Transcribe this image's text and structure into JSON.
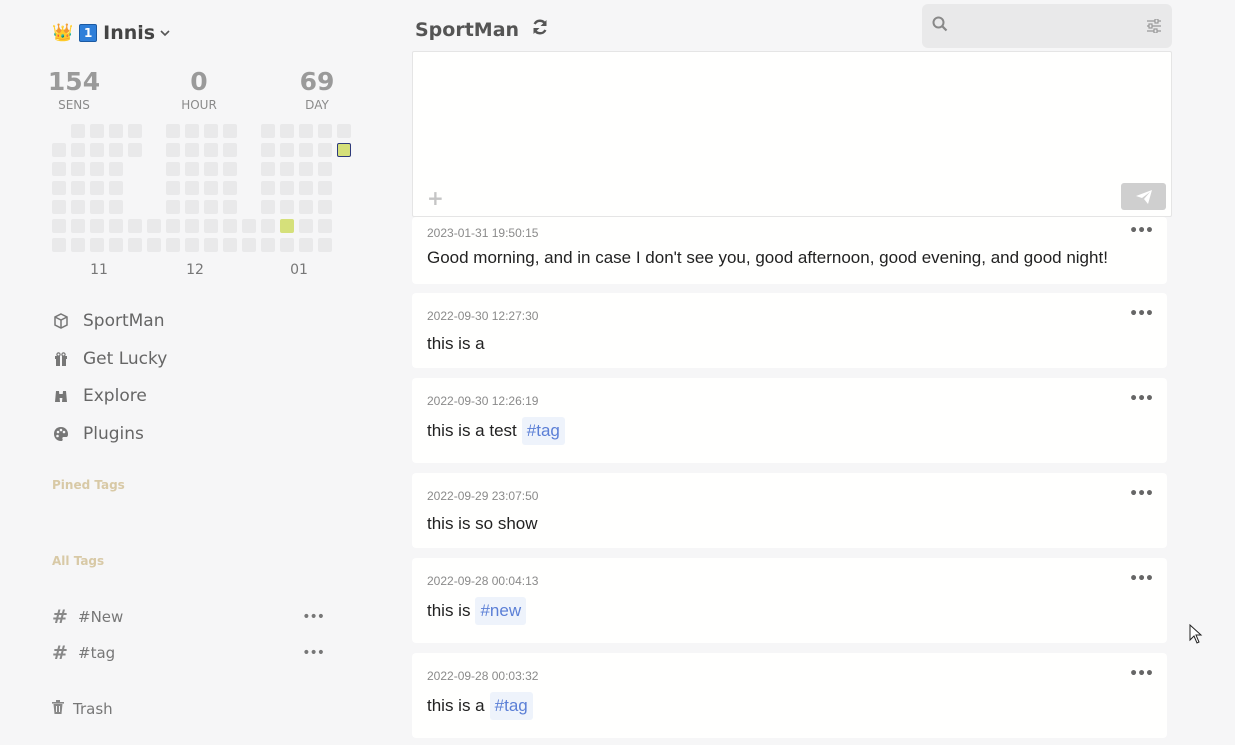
{
  "user": {
    "crown_emoji": "👑",
    "badge": "1",
    "name": "Innis"
  },
  "stats": [
    {
      "value": "154",
      "label": "SENS"
    },
    {
      "value": "0",
      "label": "HOUR"
    },
    {
      "value": "69",
      "label": "DAY"
    }
  ],
  "heatmap": {
    "months": [
      "11",
      "12",
      "01"
    ]
  },
  "nav": [
    {
      "label": "SportMan",
      "icon": "cube-icon"
    },
    {
      "label": "Get Lucky",
      "icon": "gift-icon"
    },
    {
      "label": "Explore",
      "icon": "binoculars-icon"
    },
    {
      "label": "Plugins",
      "icon": "palette-icon"
    }
  ],
  "sections": {
    "pinned": "Pined Tags",
    "all": "All Tags"
  },
  "tags": [
    {
      "label": "#New"
    },
    {
      "label": "#tag"
    }
  ],
  "trash": "Trash",
  "header": {
    "title": "SportMan"
  },
  "search": {
    "placeholder": ""
  },
  "editor": {
    "placeholder": ""
  },
  "memos": [
    {
      "timestamp": "2023-01-31 19:50:15",
      "text": "Good morning, and in case I don't see you, good afternoon, good evening, and good night!",
      "tag": ""
    },
    {
      "timestamp": "2022-09-30 12:27:30",
      "text": "this is a",
      "tag": ""
    },
    {
      "timestamp": "2022-09-30 12:26:19",
      "text": "this is a test",
      "tag": "#tag"
    },
    {
      "timestamp": "2022-09-29 23:07:50",
      "text": "this is so show",
      "tag": ""
    },
    {
      "timestamp": "2022-09-28 00:04:13",
      "text": "this is",
      "tag": "#new"
    },
    {
      "timestamp": "2022-09-28 00:03:32",
      "text": "this is a",
      "tag": "#tag"
    }
  ],
  "colors": {
    "accent": "#5b7fd6",
    "heat_active": "#d5e07a",
    "heat_empty": "#e9e9ea",
    "section_title": "#d8c9a6"
  }
}
